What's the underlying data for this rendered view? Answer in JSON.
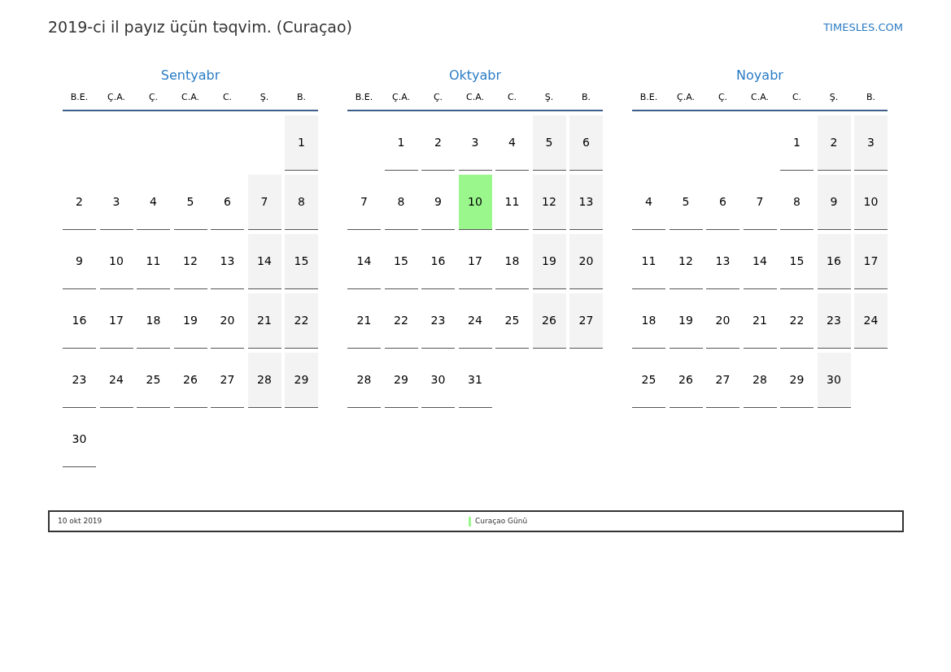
{
  "title": "2019-ci il payız üçün təqvim. (Curaçao)",
  "site_link": "TIMESLES.COM",
  "months": [
    {
      "name": "Sentyabr",
      "weekdays": [
        "B.E.",
        "Ç.A.",
        "Ç.",
        "C.A.",
        "C.",
        "Ş.",
        "B."
      ],
      "weeks": [
        [
          {
            "kind": "blank"
          },
          {
            "kind": "blank"
          },
          {
            "kind": "blank"
          },
          {
            "kind": "blank"
          },
          {
            "kind": "blank"
          },
          {
            "kind": "blank"
          },
          {
            "kind": "day",
            "day": "1",
            "weekend": true,
            "holiday": false
          }
        ],
        [
          {
            "kind": "day",
            "day": "2",
            "weekend": false,
            "holiday": false
          },
          {
            "kind": "day",
            "day": "3",
            "weekend": false,
            "holiday": false
          },
          {
            "kind": "day",
            "day": "4",
            "weekend": false,
            "holiday": false
          },
          {
            "kind": "day",
            "day": "5",
            "weekend": false,
            "holiday": false
          },
          {
            "kind": "day",
            "day": "6",
            "weekend": false,
            "holiday": false
          },
          {
            "kind": "day",
            "day": "7",
            "weekend": true,
            "holiday": false
          },
          {
            "kind": "day",
            "day": "8",
            "weekend": true,
            "holiday": false
          }
        ],
        [
          {
            "kind": "day",
            "day": "9",
            "weekend": false,
            "holiday": false
          },
          {
            "kind": "day",
            "day": "10",
            "weekend": false,
            "holiday": false
          },
          {
            "kind": "day",
            "day": "11",
            "weekend": false,
            "holiday": false
          },
          {
            "kind": "day",
            "day": "12",
            "weekend": false,
            "holiday": false
          },
          {
            "kind": "day",
            "day": "13",
            "weekend": false,
            "holiday": false
          },
          {
            "kind": "day",
            "day": "14",
            "weekend": true,
            "holiday": false
          },
          {
            "kind": "day",
            "day": "15",
            "weekend": true,
            "holiday": false
          }
        ],
        [
          {
            "kind": "day",
            "day": "16",
            "weekend": false,
            "holiday": false
          },
          {
            "kind": "day",
            "day": "17",
            "weekend": false,
            "holiday": false
          },
          {
            "kind": "day",
            "day": "18",
            "weekend": false,
            "holiday": false
          },
          {
            "kind": "day",
            "day": "19",
            "weekend": false,
            "holiday": false
          },
          {
            "kind": "day",
            "day": "20",
            "weekend": false,
            "holiday": false
          },
          {
            "kind": "day",
            "day": "21",
            "weekend": true,
            "holiday": false
          },
          {
            "kind": "day",
            "day": "22",
            "weekend": true,
            "holiday": false
          }
        ],
        [
          {
            "kind": "day",
            "day": "23",
            "weekend": false,
            "holiday": false
          },
          {
            "kind": "day",
            "day": "24",
            "weekend": false,
            "holiday": false
          },
          {
            "kind": "day",
            "day": "25",
            "weekend": false,
            "holiday": false
          },
          {
            "kind": "day",
            "day": "26",
            "weekend": false,
            "holiday": false
          },
          {
            "kind": "day",
            "day": "27",
            "weekend": false,
            "holiday": false
          },
          {
            "kind": "day",
            "day": "28",
            "weekend": true,
            "holiday": false
          },
          {
            "kind": "day",
            "day": "29",
            "weekend": true,
            "holiday": false
          }
        ],
        [
          {
            "kind": "day",
            "day": "30",
            "weekend": false,
            "holiday": false
          }
        ]
      ]
    },
    {
      "name": "Oktyabr",
      "weekdays": [
        "B.E.",
        "Ç.A.",
        "Ç.",
        "C.A.",
        "C.",
        "Ş.",
        "B."
      ],
      "weeks": [
        [
          {
            "kind": "blank"
          },
          {
            "kind": "day",
            "day": "1",
            "weekend": false,
            "holiday": false
          },
          {
            "kind": "day",
            "day": "2",
            "weekend": false,
            "holiday": false
          },
          {
            "kind": "day",
            "day": "3",
            "weekend": false,
            "holiday": false
          },
          {
            "kind": "day",
            "day": "4",
            "weekend": false,
            "holiday": false
          },
          {
            "kind": "day",
            "day": "5",
            "weekend": true,
            "holiday": false
          },
          {
            "kind": "day",
            "day": "6",
            "weekend": true,
            "holiday": false
          }
        ],
        [
          {
            "kind": "day",
            "day": "7",
            "weekend": false,
            "holiday": false
          },
          {
            "kind": "day",
            "day": "8",
            "weekend": false,
            "holiday": false
          },
          {
            "kind": "day",
            "day": "9",
            "weekend": false,
            "holiday": false
          },
          {
            "kind": "day",
            "day": "10",
            "weekend": false,
            "holiday": true
          },
          {
            "kind": "day",
            "day": "11",
            "weekend": false,
            "holiday": false
          },
          {
            "kind": "day",
            "day": "12",
            "weekend": true,
            "holiday": false
          },
          {
            "kind": "day",
            "day": "13",
            "weekend": true,
            "holiday": false
          }
        ],
        [
          {
            "kind": "day",
            "day": "14",
            "weekend": false,
            "holiday": false
          },
          {
            "kind": "day",
            "day": "15",
            "weekend": false,
            "holiday": false
          },
          {
            "kind": "day",
            "day": "16",
            "weekend": false,
            "holiday": false
          },
          {
            "kind": "day",
            "day": "17",
            "weekend": false,
            "holiday": false
          },
          {
            "kind": "day",
            "day": "18",
            "weekend": false,
            "holiday": false
          },
          {
            "kind": "day",
            "day": "19",
            "weekend": true,
            "holiday": false
          },
          {
            "kind": "day",
            "day": "20",
            "weekend": true,
            "holiday": false
          }
        ],
        [
          {
            "kind": "day",
            "day": "21",
            "weekend": false,
            "holiday": false
          },
          {
            "kind": "day",
            "day": "22",
            "weekend": false,
            "holiday": false
          },
          {
            "kind": "day",
            "day": "23",
            "weekend": false,
            "holiday": false
          },
          {
            "kind": "day",
            "day": "24",
            "weekend": false,
            "holiday": false
          },
          {
            "kind": "day",
            "day": "25",
            "weekend": false,
            "holiday": false
          },
          {
            "kind": "day",
            "day": "26",
            "weekend": true,
            "holiday": false
          },
          {
            "kind": "day",
            "day": "27",
            "weekend": true,
            "holiday": false
          }
        ],
        [
          {
            "kind": "day",
            "day": "28",
            "weekend": false,
            "holiday": false
          },
          {
            "kind": "day",
            "day": "29",
            "weekend": false,
            "holiday": false
          },
          {
            "kind": "day",
            "day": "30",
            "weekend": false,
            "holiday": false
          },
          {
            "kind": "day",
            "day": "31",
            "weekend": false,
            "holiday": false
          }
        ]
      ]
    },
    {
      "name": "Noyabr",
      "weekdays": [
        "B.E.",
        "Ç.A.",
        "Ç.",
        "C.A.",
        "C.",
        "Ş.",
        "B."
      ],
      "weeks": [
        [
          {
            "kind": "blank"
          },
          {
            "kind": "blank"
          },
          {
            "kind": "blank"
          },
          {
            "kind": "blank"
          },
          {
            "kind": "day",
            "day": "1",
            "weekend": false,
            "holiday": false
          },
          {
            "kind": "day",
            "day": "2",
            "weekend": true,
            "holiday": false
          },
          {
            "kind": "day",
            "day": "3",
            "weekend": true,
            "holiday": false
          }
        ],
        [
          {
            "kind": "day",
            "day": "4",
            "weekend": false,
            "holiday": false
          },
          {
            "kind": "day",
            "day": "5",
            "weekend": false,
            "holiday": false
          },
          {
            "kind": "day",
            "day": "6",
            "weekend": false,
            "holiday": false
          },
          {
            "kind": "day",
            "day": "7",
            "weekend": false,
            "holiday": false
          },
          {
            "kind": "day",
            "day": "8",
            "weekend": false,
            "holiday": false
          },
          {
            "kind": "day",
            "day": "9",
            "weekend": true,
            "holiday": false
          },
          {
            "kind": "day",
            "day": "10",
            "weekend": true,
            "holiday": false
          }
        ],
        [
          {
            "kind": "day",
            "day": "11",
            "weekend": false,
            "holiday": false
          },
          {
            "kind": "day",
            "day": "12",
            "weekend": false,
            "holiday": false
          },
          {
            "kind": "day",
            "day": "13",
            "weekend": false,
            "holiday": false
          },
          {
            "kind": "day",
            "day": "14",
            "weekend": false,
            "holiday": false
          },
          {
            "kind": "day",
            "day": "15",
            "weekend": false,
            "holiday": false
          },
          {
            "kind": "day",
            "day": "16",
            "weekend": true,
            "holiday": false
          },
          {
            "kind": "day",
            "day": "17",
            "weekend": true,
            "holiday": false
          }
        ],
        [
          {
            "kind": "day",
            "day": "18",
            "weekend": false,
            "holiday": false
          },
          {
            "kind": "day",
            "day": "19",
            "weekend": false,
            "holiday": false
          },
          {
            "kind": "day",
            "day": "20",
            "weekend": false,
            "holiday": false
          },
          {
            "kind": "day",
            "day": "21",
            "weekend": false,
            "holiday": false
          },
          {
            "kind": "day",
            "day": "22",
            "weekend": false,
            "holiday": false
          },
          {
            "kind": "day",
            "day": "23",
            "weekend": true,
            "holiday": false
          },
          {
            "kind": "day",
            "day": "24",
            "weekend": true,
            "holiday": false
          }
        ],
        [
          {
            "kind": "day",
            "day": "25",
            "weekend": false,
            "holiday": false
          },
          {
            "kind": "day",
            "day": "26",
            "weekend": false,
            "holiday": false
          },
          {
            "kind": "day",
            "day": "27",
            "weekend": false,
            "holiday": false
          },
          {
            "kind": "day",
            "day": "28",
            "weekend": false,
            "holiday": false
          },
          {
            "kind": "day",
            "day": "29",
            "weekend": false,
            "holiday": false
          },
          {
            "kind": "day",
            "day": "30",
            "weekend": true,
            "holiday": false
          }
        ]
      ]
    }
  ],
  "holidays": [
    {
      "date": "10 okt 2019",
      "name": "Curaçao Günü",
      "color": "#99f78c"
    }
  ]
}
